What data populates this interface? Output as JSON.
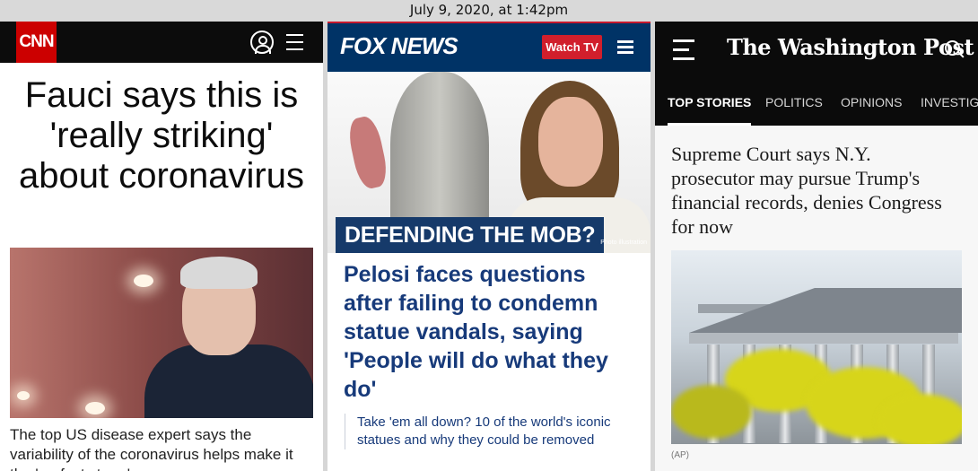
{
  "timestamp": "July 9, 2020, at 1:42pm",
  "cnn": {
    "logo": "CNN",
    "headline": "Fauci says this is 'really striking' about coronavirus",
    "subhead": "The top US disease expert says the variability of the coronavirus helps make it the 'perfect storm'",
    "icons": [
      "user-icon",
      "menu-icon"
    ]
  },
  "fox": {
    "logo": "FOX NEWS",
    "watch_label": "Watch TV",
    "banner": "DEFENDING THE MOB?",
    "photo_credit": "Photo illustration",
    "headline": "Pelosi faces questions after failing to condemn statue vandals, saying 'People will do what they do'",
    "related": "Take 'em all down? 10 of the world's iconic statues and why they could be removed",
    "colors": {
      "bar": "#003366",
      "accent": "#d11f2c"
    }
  },
  "wapo": {
    "logo": "The Washington Post",
    "tabs": [
      "TOP STORIES",
      "POLITICS",
      "OPINIONS",
      "INVESTIGA"
    ],
    "headline": "Supreme Court says N.Y. prosecutor may pursue Trump's financial records, denies Congress for now",
    "photo_credit": "(AP)"
  }
}
